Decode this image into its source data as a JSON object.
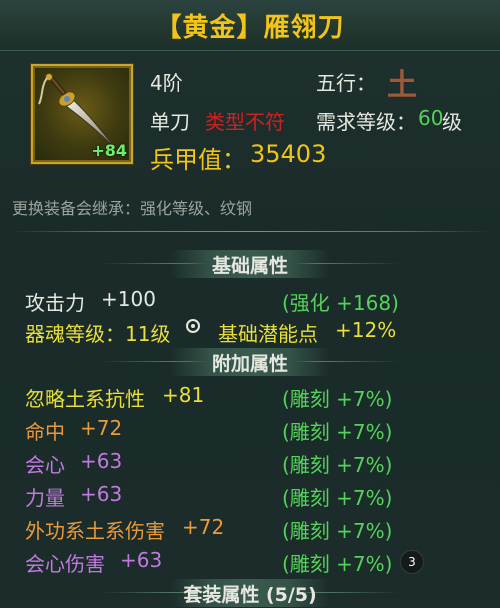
{
  "item": {
    "title": "【黄金】雁翎刀",
    "icon": "saber-icon",
    "enhance_level": "+84",
    "tier": "4阶",
    "element_label": "五行：",
    "element_glyph": "土",
    "weapon_type": "单刀",
    "type_mismatch": "类型不符",
    "req_level_label": "需求等级：",
    "req_level_value": "60",
    "req_level_unit": "级",
    "power_label": "兵甲值：",
    "power_value": "35403",
    "inherit_note": "更换装备会继承：强化等级、纹钢"
  },
  "sections": {
    "base": "基础属性",
    "extra": "附加属性",
    "set": "套装属性 (5/5)"
  },
  "base_stats": {
    "attack_label": "攻击力",
    "attack_value": "+100",
    "attack_bonus": "(强化 +168)",
    "soul_label": "器魂等级：11级",
    "potential_label": "基础潜能点",
    "potential_value": "+12%"
  },
  "extra_stats": [
    {
      "name": "忽略土系抗性",
      "value": "+81",
      "bonus": "(雕刻 +7%)",
      "color": "#e8df3a"
    },
    {
      "name": "命中",
      "value": "+72",
      "bonus": "(雕刻 +7%)",
      "color": "#e89a3c"
    },
    {
      "name": "会心",
      "value": "+63",
      "bonus": "(雕刻 +7%)",
      "color": "#c07adf"
    },
    {
      "name": "力量",
      "value": "+63",
      "bonus": "(雕刻 +7%)",
      "color": "#c07adf"
    },
    {
      "name": "外功系土系伤害",
      "value": "+72",
      "bonus": "(雕刻 +7%)",
      "color": "#e89a3c"
    },
    {
      "name": "会心伤害",
      "value": "+63",
      "bonus": "(雕刻 +7%)",
      "color": "#c07adf"
    }
  ],
  "badge_count": "3",
  "colors": {
    "gold": "#f2c318",
    "green": "#54d25a",
    "red": "#d21f1f",
    "background": "#1c2d2c"
  }
}
